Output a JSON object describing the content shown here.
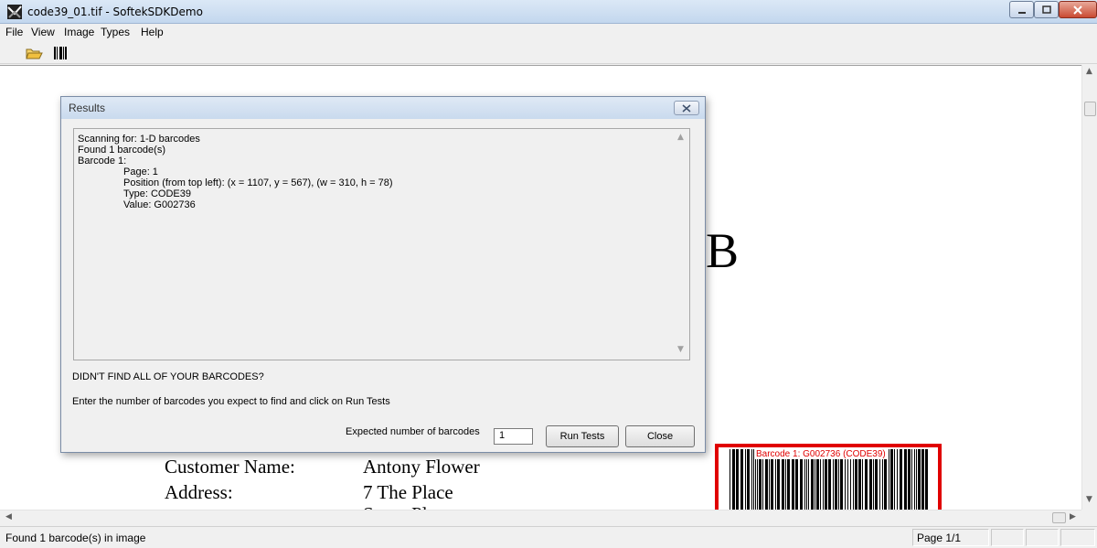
{
  "window": {
    "title": "code39_01.tif - SoftekSDKDemo"
  },
  "menu": [
    "File",
    "View",
    "Image",
    "Types",
    "Help"
  ],
  "toolbar": {
    "icons": [
      "open-folder-icon",
      "barcode-scan-icon"
    ]
  },
  "document": {
    "large_letter": "B",
    "customer_name_label": "Customer Name:",
    "customer_name_value": "Antony Flower",
    "address_label": "Address:",
    "address_line1": "7 The Place",
    "barcode_overlay_label": "Barcode 1: G002736 (CODE39)",
    "highlight_color": "#e00000"
  },
  "dialog": {
    "title": "Results",
    "results_lines": [
      "Scanning for: 1-D barcodes",
      "Found 1 barcode(s)",
      "Barcode 1:"
    ],
    "barcode_details": [
      "Page: 1",
      "Position (from top left): (x = 1107, y = 567), (w = 310, h = 78)",
      "Type: CODE39",
      "Value: G002736"
    ],
    "didnt_find": "DIDN'T FIND ALL OF YOUR BARCODES?",
    "instructions": "Enter the number of barcodes you expect to find and click on Run Tests",
    "expected_label": "Expected number of barcodes",
    "expected_value": "1",
    "run_tests_label": "Run Tests",
    "close_label": "Close"
  },
  "status": {
    "message": "Found 1 barcode(s) in image",
    "page": "Page 1/1"
  }
}
